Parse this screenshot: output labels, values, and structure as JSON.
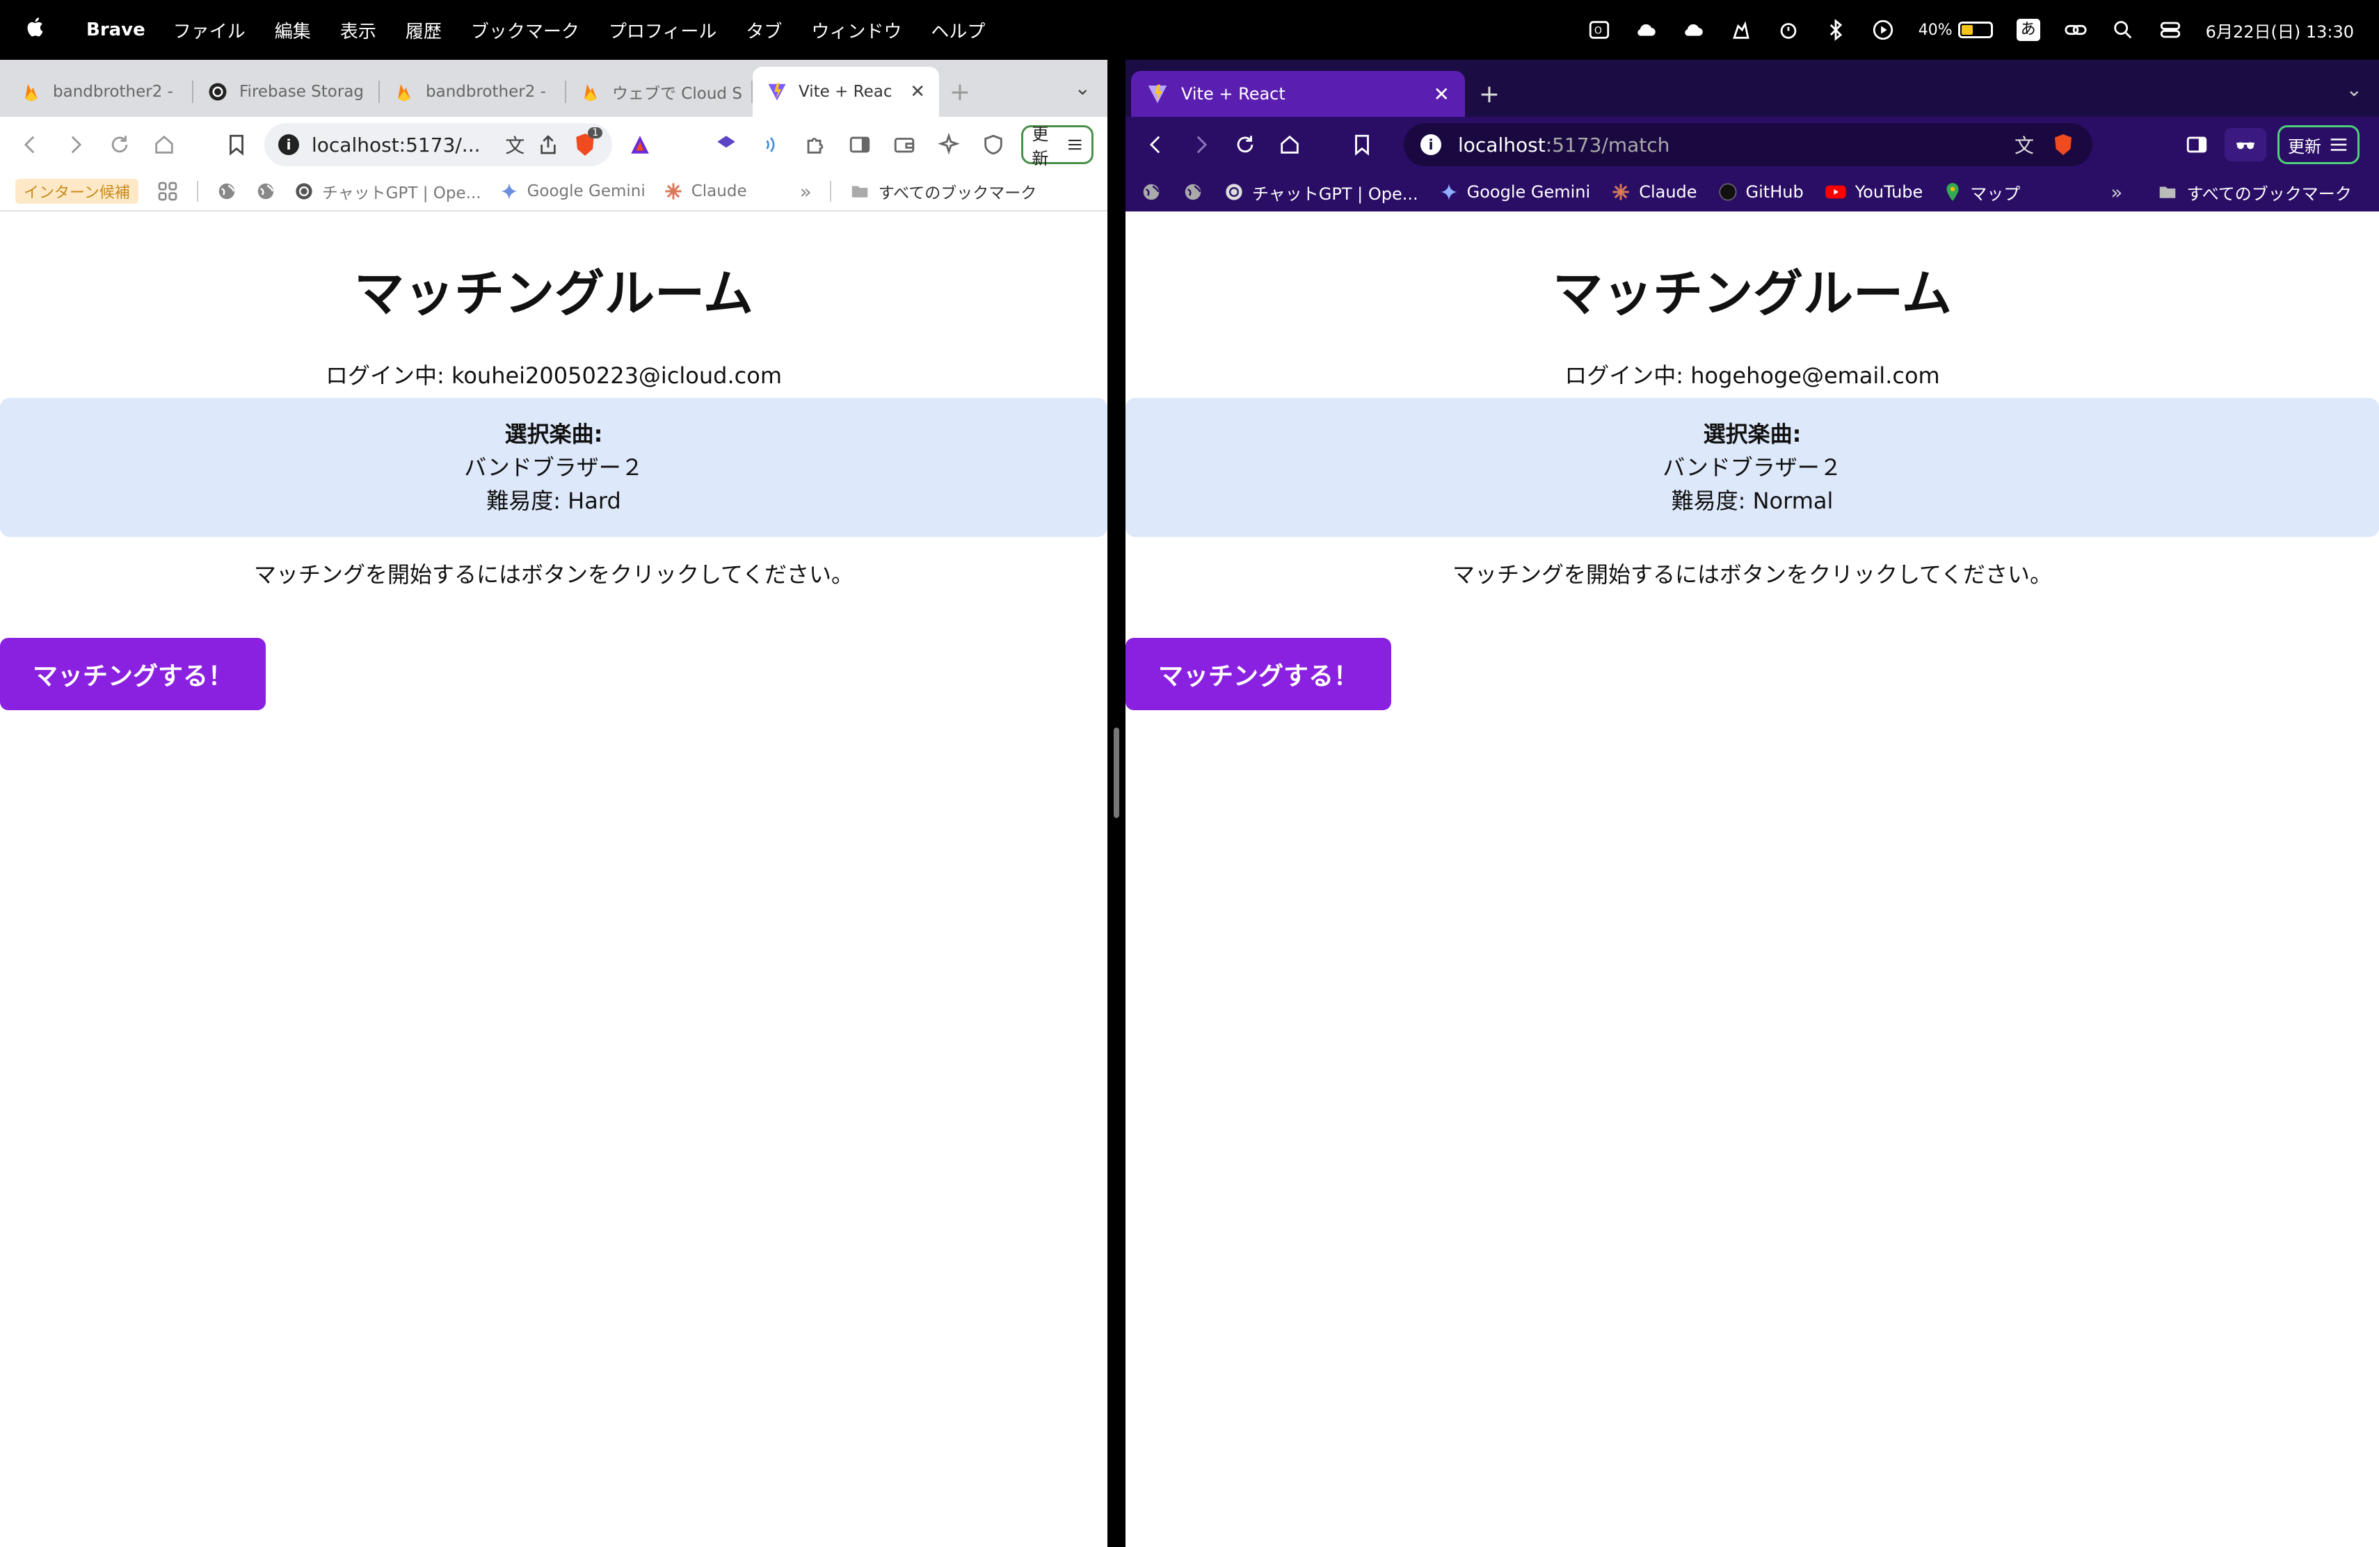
{
  "menubar": {
    "app_name": "Brave",
    "menus": [
      "ファイル",
      "編集",
      "表示",
      "履歴",
      "ブックマーク",
      "プロフィール",
      "タブ",
      "ウィンドウ",
      "ヘルプ"
    ],
    "battery_percent": "40%",
    "battery_level": 0.4,
    "ime": "あ",
    "datetime": "6月22日(日) 13:30"
  },
  "left": {
    "tabs": [
      {
        "label": "bandbrother2 -",
        "icon": "firebase-icon"
      },
      {
        "label": "Firebase Storag",
        "icon": "openai-icon"
      },
      {
        "label": "bandbrother2 -",
        "icon": "firebase-icon"
      },
      {
        "label": "ウェブで Cloud S",
        "icon": "firebase-icon"
      },
      {
        "label": "Vite + Reac",
        "icon": "vite-icon"
      }
    ],
    "url": "localhost:5173/...",
    "shield_badge": "1",
    "update_label": "更新",
    "bookmarks": {
      "chip": "インターン候補",
      "items": [
        "チャットGPT | Ope...",
        "Google Gemini",
        "Claude"
      ],
      "all": "すべてのブックマーク"
    },
    "page": {
      "title": "マッチングルーム",
      "login": "ログイン中: kouhei20050223@icloud.com",
      "song_label": "選択楽曲:",
      "song_name": "バンドブラザー２",
      "difficulty": "難易度: Hard",
      "hint": "マッチングを開始するにはボタンをクリックしてください。",
      "button": "マッチングする！"
    }
  },
  "right": {
    "tab_label": "Vite + React",
    "url_host": "localhost",
    "url_path": ":5173/match",
    "update_label": "更新",
    "bookmarks": {
      "items": [
        "チャットGPT | Ope...",
        "Google Gemini",
        "Claude",
        "GitHub",
        "YouTube",
        "マップ"
      ],
      "all": "すべてのブックマーク"
    },
    "page": {
      "title": "マッチングルーム",
      "login": "ログイン中: hogehoge@email.com",
      "song_label": "選択楽曲:",
      "song_name": "バンドブラザー２",
      "difficulty": "難易度: Normal",
      "hint": "マッチングを開始するにはボタンをクリックしてください。",
      "button": "マッチングする！"
    }
  },
  "colors": {
    "accent_button": "#8a20e0",
    "song_box": "#dde8fa",
    "dark_chrome": "#2a0e66"
  }
}
